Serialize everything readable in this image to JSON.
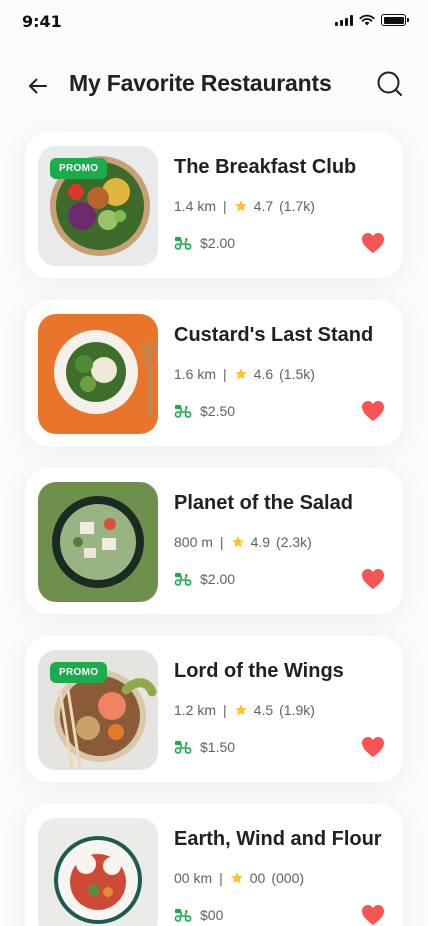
{
  "status": {
    "time": "9:41"
  },
  "header": {
    "title": "My Favorite Restaurants"
  },
  "colors": {
    "accent": "#1bac4b",
    "star": "#ffc02d",
    "heart": "#f75555",
    "text": "#212121",
    "muted": "#616161"
  },
  "restaurants": [
    {
      "name": "The Breakfast Club",
      "distance": "1.4 km",
      "rating": "4.7",
      "reviews": "(1.7k)",
      "delivery": "$2.00",
      "promo": "PROMO",
      "favorite": true
    },
    {
      "name": "Custard's Last Stand",
      "distance": "1.6 km",
      "rating": "4.6",
      "reviews": "(1.5k)",
      "delivery": "$2.50",
      "promo": "",
      "favorite": true
    },
    {
      "name": "Planet of the Salad",
      "distance": "800 m",
      "rating": "4.9",
      "reviews": "(2.3k)",
      "delivery": "$2.00",
      "promo": "",
      "favorite": true
    },
    {
      "name": "Lord of the Wings",
      "distance": "1.2 km",
      "rating": "4.5",
      "reviews": "(1.9k)",
      "delivery": "$1.50",
      "promo": "PROMO",
      "favorite": true
    },
    {
      "name": "Earth, Wind and Flour",
      "distance": "00 km",
      "rating": "00",
      "reviews": "(000)",
      "delivery": "$00",
      "promo": "",
      "favorite": true
    }
  ]
}
